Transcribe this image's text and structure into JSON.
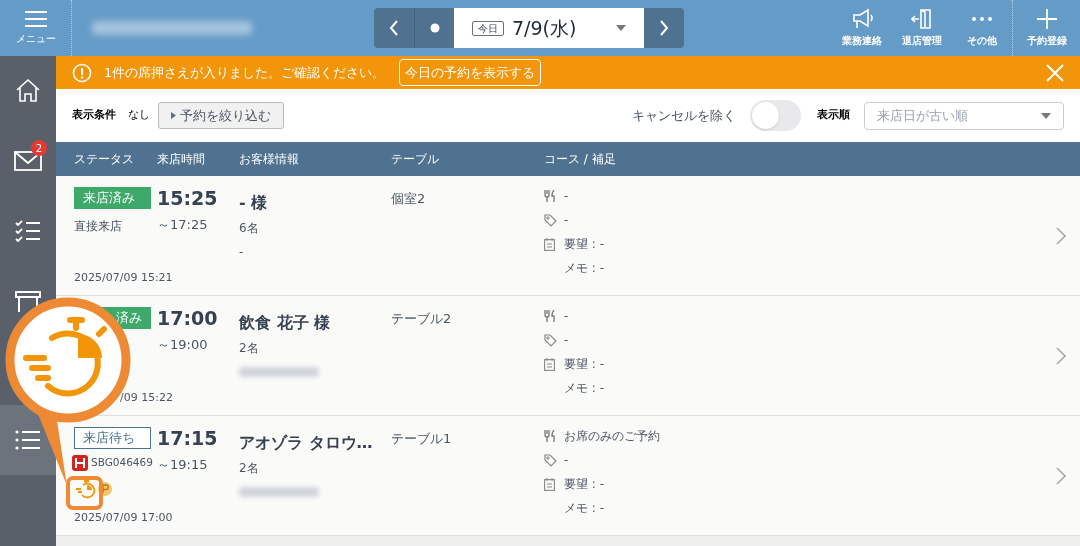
{
  "header": {
    "menu_label": "メニュー",
    "store_name_blurred": true,
    "date_nav": {
      "today_label": "今日",
      "date": "7/9(水)"
    },
    "actions": [
      {
        "kind": "megaphone",
        "label": "業務連絡"
      },
      {
        "kind": "door",
        "label": "退店管理"
      },
      {
        "kind": "more",
        "label": "その他"
      },
      {
        "kind": "plus",
        "label": "予約登録"
      }
    ]
  },
  "sidebar": {
    "items": [
      {
        "kind": "home",
        "selected": false
      },
      {
        "kind": "mail",
        "badge": "2",
        "selected": false
      },
      {
        "kind": "checklist",
        "selected": false
      },
      {
        "kind": "table",
        "selected": false
      },
      {
        "kind": "list",
        "selected": true
      }
    ]
  },
  "notice": {
    "message": "1件の席押さえが入りました。ご確認ください。",
    "button": "今日の予約を表示する"
  },
  "filters": {
    "condition_label": "表示条件",
    "condition_value": "なし",
    "filter_button": "予約を絞り込む",
    "cancel_toggle": {
      "label": "キャンセルを除く",
      "on": false
    },
    "sort": {
      "label": "表示順",
      "placeholder": "来店日が古い順"
    }
  },
  "table": {
    "columns": [
      "ステータス",
      "来店時間",
      "お客様情報",
      "テーブル",
      "コース / 補足"
    ],
    "rows": [
      {
        "status": {
          "kind": "arrived",
          "label": "来店済み"
        },
        "source": "直接来店",
        "created": "2025/07/09 15:21",
        "start": "15:25",
        "end": "～17:25",
        "guest": "- 様",
        "party": "6名",
        "contact": "-",
        "table": "個室2",
        "course": "-",
        "tag": "-",
        "request": "要望 : -",
        "memo": "メモ : -"
      },
      {
        "status": {
          "kind": "arrived",
          "label": "済み"
        },
        "created": "/09 15:22",
        "start": "17:00",
        "end": "～19:00",
        "guest": "飲食 花子 様",
        "party": "2名",
        "contact_blurred": true,
        "table": "テーブル2",
        "course": "-",
        "tag": "-",
        "request": "要望 : -",
        "memo": "メモ : -"
      },
      {
        "status": {
          "kind": "waiting",
          "label": "来店待ち"
        },
        "reservation_id": "SBG046469",
        "icons": [
          {
            "kind": "timer"
          },
          {
            "kind": "points"
          }
        ],
        "created": "2025/07/09 17:00",
        "start": "17:15",
        "end": "～19:15",
        "guest": "アオゾラ タロウ…",
        "party": "2名",
        "contact_blurred": true,
        "table": "テーブル1",
        "course": "お席のみのご予約",
        "tag": "-",
        "request": "要望 : -",
        "memo": "メモ : -"
      }
    ]
  }
}
